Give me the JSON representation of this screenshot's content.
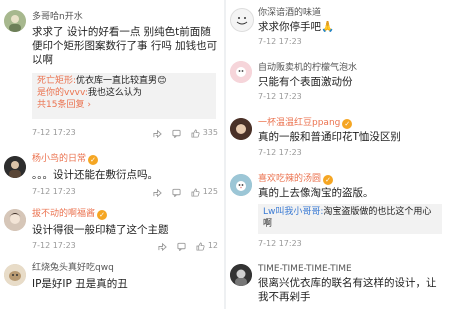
{
  "left": [
    {
      "username": "多哥哈n开水",
      "text": "求求了 设计的好看一点 别纯色t前面随便印个矩形图案数行了事 行吗 加钱也可以啊",
      "replies": [
        {
          "name": "死亡矩形:",
          "text": "优衣库一直比较直男"
        },
        {
          "name": "是你的vvvv:",
          "text": "我也这么认为"
        }
      ],
      "more_replies": "共15条回复",
      "time": "7-12 17:23",
      "likes": "335"
    },
    {
      "username": "杨小鸟的日常",
      "text": "。。。设计还能在敷衍点吗。",
      "time": "7-12 17:23",
      "likes": "125"
    },
    {
      "username": "拔不动的啊福酱",
      "text": "设计得很一般印糙了这个主题",
      "time": "7-12 17:23",
      "likes": "12"
    },
    {
      "username": "红烧兔头真好吃qwq",
      "text": "IP是好IP 丑是真的丑"
    }
  ],
  "right": [
    {
      "username": "你深谙酒的味道",
      "text": "求求你停手吧",
      "time": "7-12 17:23"
    },
    {
      "username": "自动贩卖机的柠檬气泡水",
      "text": "只能有个表面激动份",
      "time": "7-12 17:23"
    },
    {
      "username": "一杯温温红豆ppang",
      "text": "真的一般和普通印花T恤没区别",
      "time": "7-12 17:23"
    },
    {
      "username": "喜欢吃辣的汤圆",
      "text": "真的上去像淘宝的盗版。",
      "replies": [
        {
          "name": "Lw叫我小哥哥:",
          "text": "淘宝盗版做的也比这个用心啊"
        }
      ],
      "time": "7-12 17:23"
    },
    {
      "username": "TIME-TIME-TIME-TIME",
      "text": "很离兴优衣库的联名有这样的设计，让我不再剁手"
    }
  ],
  "colors": {
    "accent": "#eb7350",
    "meta": "#999999",
    "quote_bg": "#f2f2f2"
  },
  "icons": [
    "share-icon",
    "comment-icon",
    "like-icon",
    "verified-badge-icon"
  ]
}
